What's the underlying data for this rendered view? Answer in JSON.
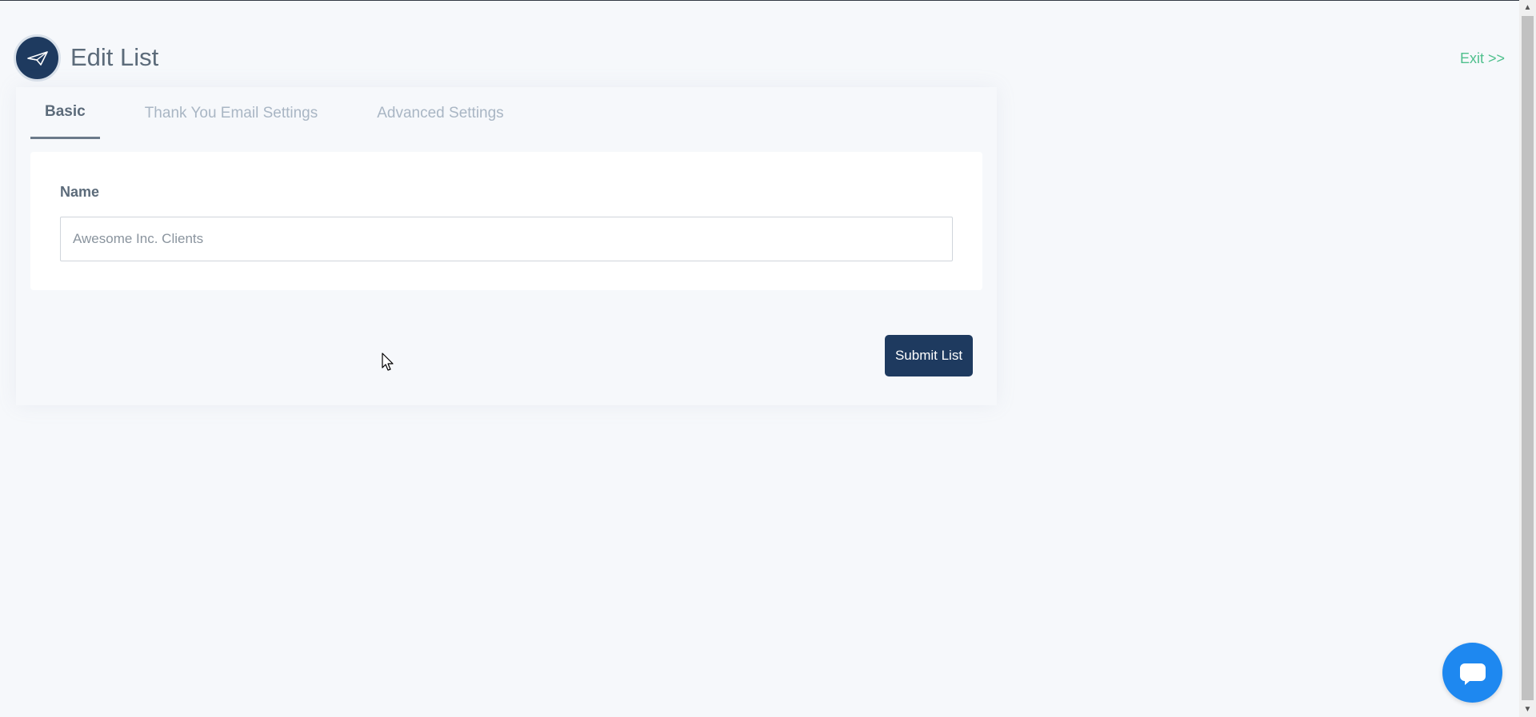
{
  "header": {
    "title": "Edit List",
    "exit_label": "Exit >>",
    "logo_icon": "paper-plane-icon"
  },
  "tabs": [
    {
      "label": "Basic",
      "active": true
    },
    {
      "label": "Thank You Email Settings",
      "active": false
    },
    {
      "label": "Advanced Settings",
      "active": false
    }
  ],
  "form": {
    "name_label": "Name",
    "name_value": "",
    "name_placeholder": "Awesome Inc. Clients",
    "submit_label": "Submit List"
  },
  "colors": {
    "primary": "#1e3a5f",
    "exit_link": "#4fc08d",
    "chat_button": "#1e88f0",
    "background": "#f6f8fb"
  },
  "chat": {
    "icon": "chat-bubble-icon"
  }
}
